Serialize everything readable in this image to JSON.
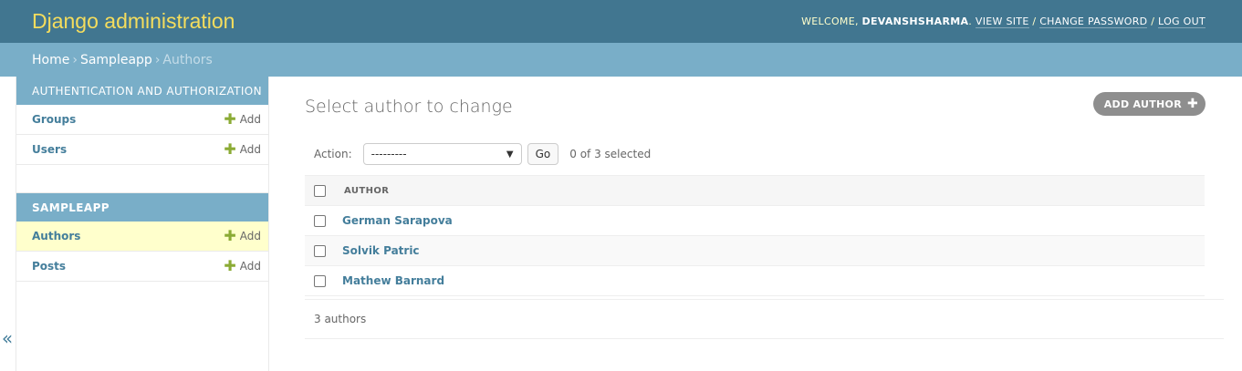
{
  "header": {
    "branding": "Django administration",
    "welcome": "WELCOME,",
    "username": "DEVANSHSHARMA",
    "view_site": "VIEW SITE",
    "change_password": "CHANGE PASSWORD",
    "log_out": "LOG OUT",
    "sep": "/"
  },
  "breadcrumbs": {
    "home": "Home",
    "app": "Sampleapp",
    "current": "Authors",
    "sep": "›"
  },
  "sidebar": {
    "modules": [
      {
        "caption": "AUTHENTICATION AND AUTHORIZATION",
        "items": [
          {
            "label": "Groups",
            "add": "Add"
          },
          {
            "label": "Users",
            "add": "Add"
          }
        ]
      },
      {
        "caption": "SAMPLEAPP",
        "items": [
          {
            "label": "Authors",
            "add": "Add"
          },
          {
            "label": "Posts",
            "add": "Add"
          }
        ]
      }
    ],
    "toggle": "«"
  },
  "content": {
    "title": "Select author to change",
    "add_button": "ADD AUTHOR",
    "action_label": "Action:",
    "action_select": "---------",
    "go_button": "Go",
    "selected_count": "0 of 3 selected",
    "column_header": "AUTHOR",
    "rows": [
      "German Sarapova",
      "Solvik Patric",
      "Mathew Barnard"
    ],
    "paginator": "3 authors"
  },
  "colors": {
    "header_bg": "#417690",
    "breadcrumb_bg": "#79aec8",
    "branding": "#f5dd5d",
    "link": "#447e9b",
    "current_row": "#ffffcc"
  }
}
